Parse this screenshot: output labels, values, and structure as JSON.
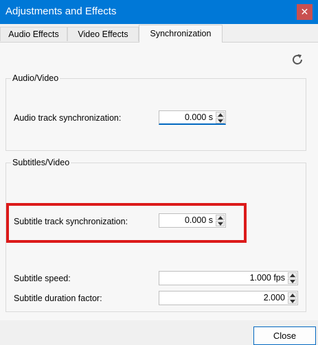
{
  "window": {
    "title": "Adjustments and Effects",
    "close_glyph": "✕"
  },
  "tabs": [
    {
      "label": "Audio Effects",
      "active": false
    },
    {
      "label": "Video Effects",
      "active": false
    },
    {
      "label": "Synchronization",
      "active": true
    }
  ],
  "toolbar": {
    "reset_icon": "refresh-icon"
  },
  "groups": {
    "audio_video": {
      "title": "Audio/Video",
      "audio_sync": {
        "label": "Audio track synchronization:",
        "value": "0.000 s"
      }
    },
    "subtitles_video": {
      "title": "Subtitles/Video",
      "subtitle_sync": {
        "label": "Subtitle track synchronization:",
        "value": "0.000 s"
      },
      "subtitle_speed": {
        "label": "Subtitle speed:",
        "value": "1.000 fps"
      },
      "subtitle_duration": {
        "label": "Subtitle duration factor:",
        "value": "2.000"
      }
    }
  },
  "footer": {
    "close_label": "Close"
  },
  "colors": {
    "titlebar": "#0078d7",
    "highlight": "#dc1a1a",
    "focus": "#0067c0"
  }
}
